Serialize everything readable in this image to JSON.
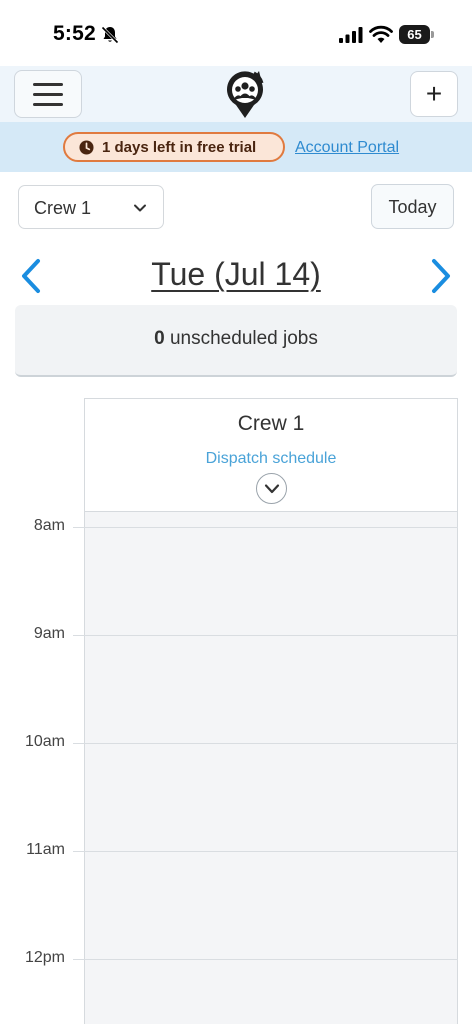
{
  "status_bar": {
    "time": "5:52",
    "battery": "65"
  },
  "header": {
    "menu_icon": "hamburger-icon",
    "logo_icon": "crew-location-logo",
    "add_label": "+"
  },
  "trial_banner": {
    "trial_text": "1 days left in free trial",
    "account_link": "Account Portal",
    "colors": {
      "pill_border": "#e07a3f",
      "pill_bg": "#fbe6d8",
      "banner_bg": "#d5e9f7",
      "link": "#2f8bd0"
    }
  },
  "controls": {
    "crew_select_value": "Crew 1",
    "today_label": "Today"
  },
  "date_nav": {
    "date_label": "Tue (Jul 14)",
    "prev_icon": "chevron-left-icon",
    "next_icon": "chevron-right-icon",
    "accent": "#1a8de0"
  },
  "unscheduled": {
    "count": "0",
    "label": "unscheduled jobs"
  },
  "schedule": {
    "crew_name": "Crew 1",
    "dispatch_link": "Dispatch schedule",
    "hours": [
      "8am",
      "9am",
      "10am",
      "11am",
      "12pm"
    ]
  }
}
